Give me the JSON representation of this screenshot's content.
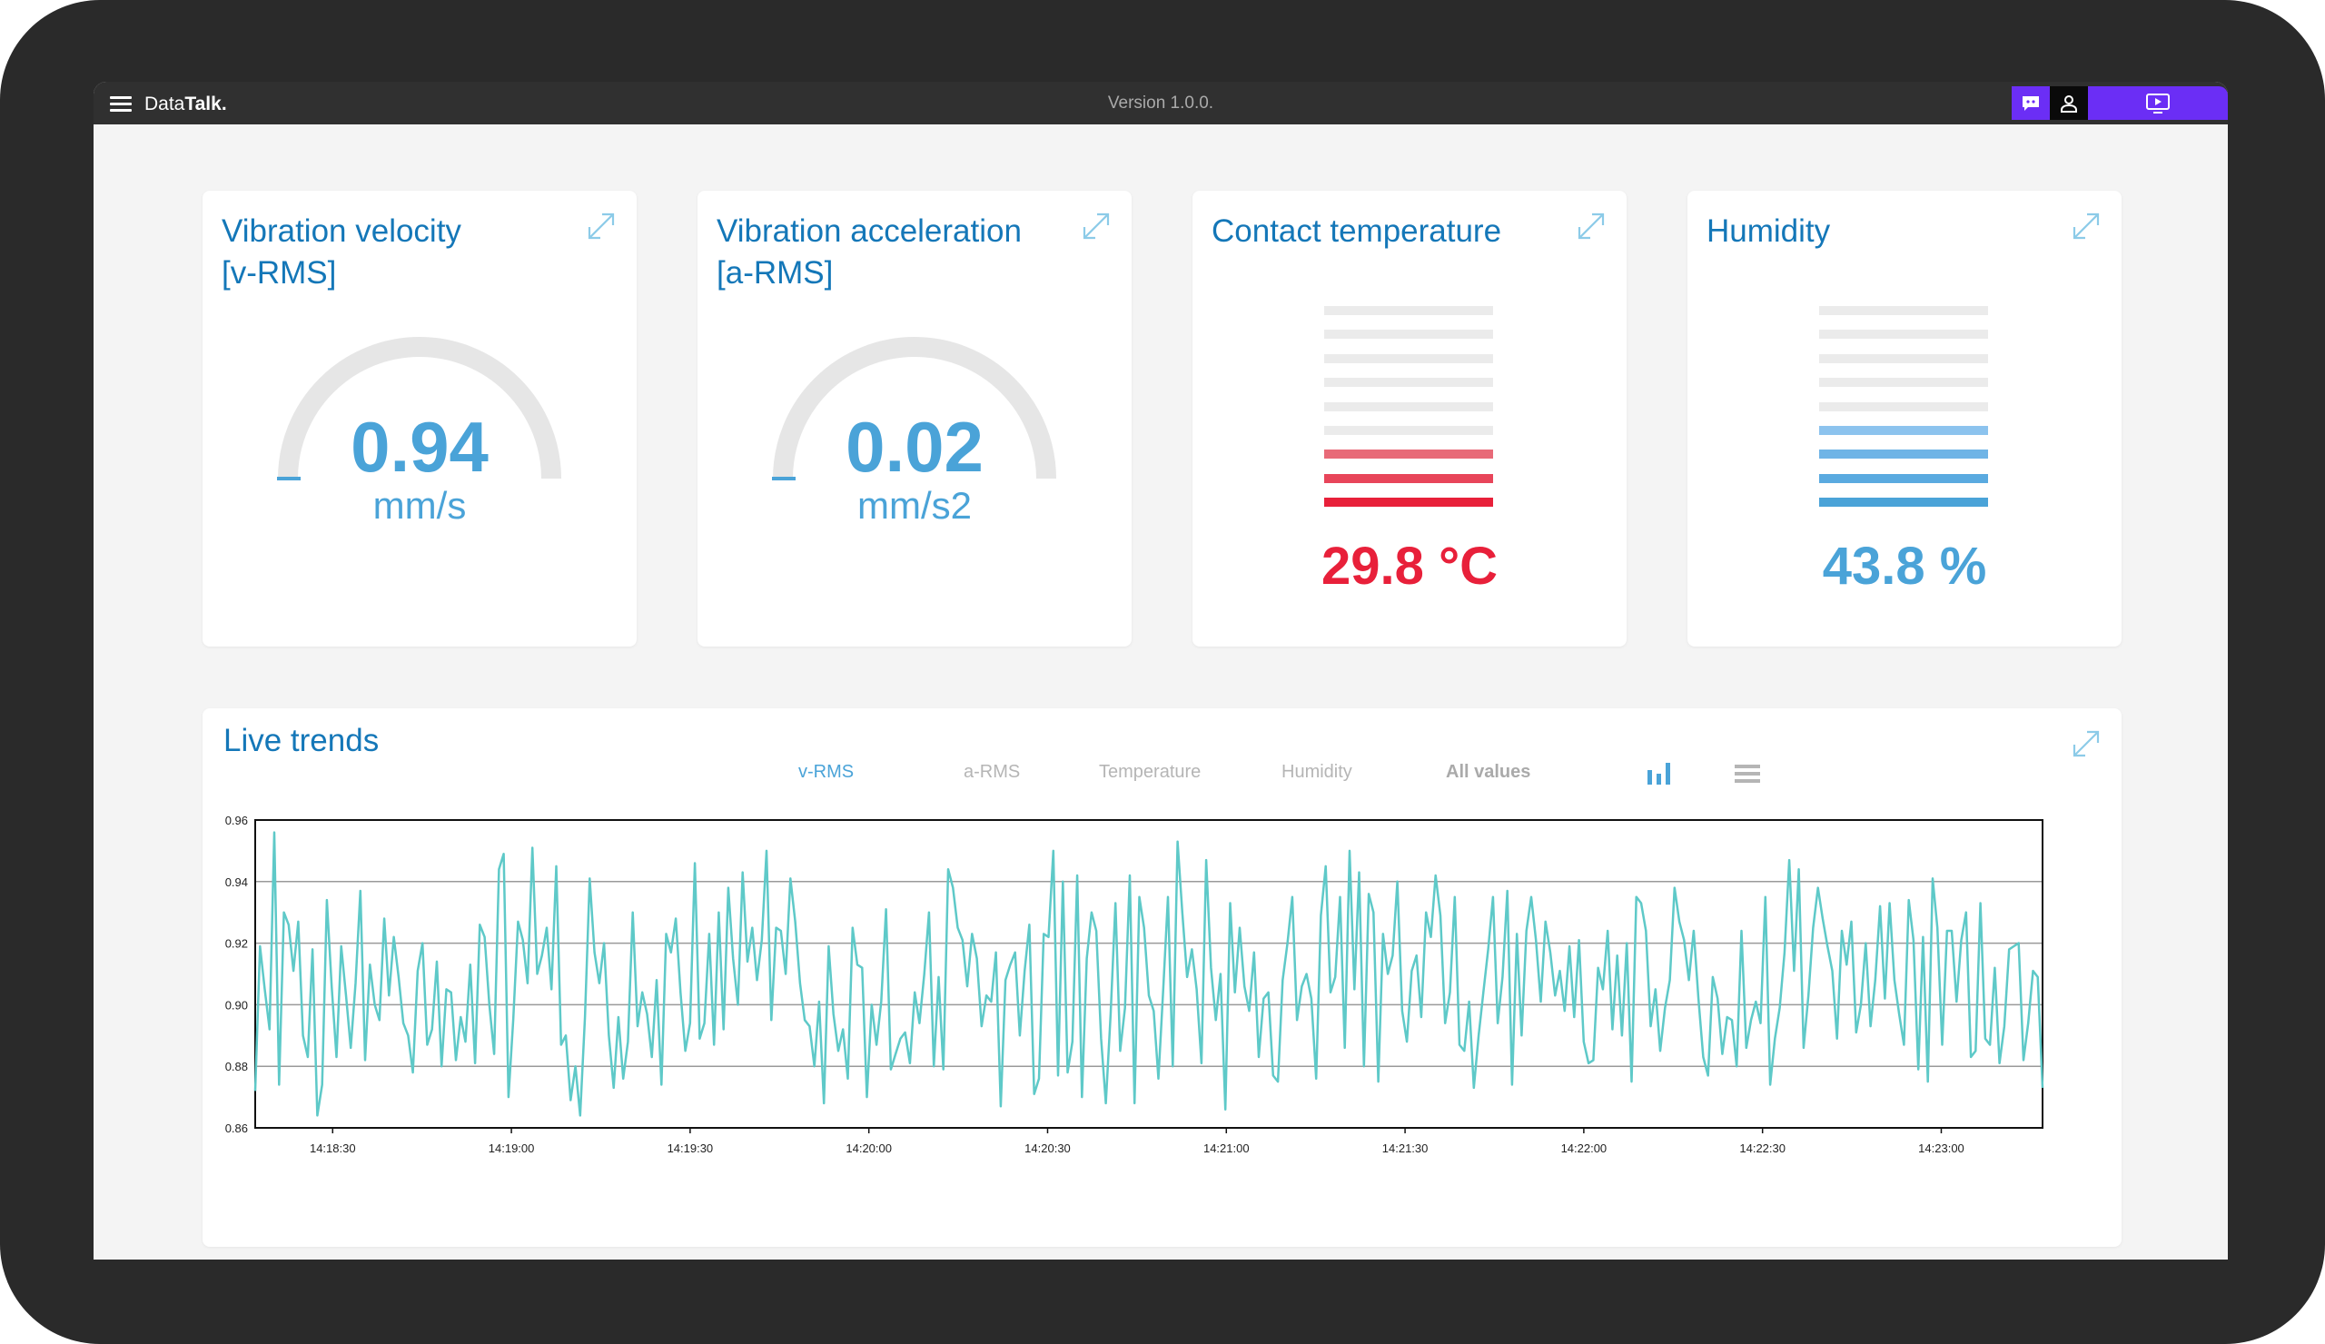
{
  "app": {
    "brand_light": "Data",
    "brand_bold": "Talk.",
    "version": "Version 1.0.0."
  },
  "toolbar": {
    "chat_icon": "chat-bubble-icon",
    "user_icon": "user-icon",
    "screen_icon": "monitor-play-icon"
  },
  "cards": [
    {
      "title_line1": "Vibration velocity",
      "title_line2": "[v-RMS]",
      "value": "0.94",
      "unit": "mm/s",
      "gauge_fraction": 0.05,
      "color": "#4aa3d8"
    },
    {
      "title_line1": "Vibration acceleration",
      "title_line2": "[a-RMS]",
      "value": "0.02",
      "unit": "mm/s2",
      "gauge_fraction": 0.02,
      "color": "#4aa3d8"
    },
    {
      "title_line1": "Contact temperature",
      "title_line2": "",
      "value": "29.8 °C",
      "level_bars": 3,
      "total_bars": 9,
      "color": "#e8203a"
    },
    {
      "title_line1": "Humidity",
      "title_line2": "",
      "value": "43.8 %",
      "level_bars": 4,
      "total_bars": 9,
      "color": "#4aa3d8"
    }
  ],
  "trends": {
    "title": "Live trends",
    "tabs": [
      "v-RMS",
      "a-RMS",
      "Temperature",
      "Humidity",
      "All values"
    ],
    "active_tab": "v-RMS",
    "icons": [
      "bar-chart-icon",
      "list-icon"
    ]
  },
  "colors": {
    "accent_blue": "#1477b8",
    "value_blue": "#4aa3d8",
    "temp_red": "#e8203a",
    "purple": "#6b2ef5",
    "line": "#5ec9c8"
  },
  "chart_data": {
    "type": "line",
    "title": "",
    "xlabel": "",
    "ylabel": "",
    "ylim": [
      0.86,
      0.96
    ],
    "yticks": [
      "0.96",
      "0.94",
      "0.92",
      "0.90",
      "0.88",
      "0.86"
    ],
    "xticks": [
      "14:18:30",
      "14:19:00",
      "14:19:30",
      "14:20:00",
      "14:20:30",
      "14:21:00",
      "14:21:30",
      "14:22:00",
      "14:22:30",
      "14:23:00"
    ],
    "x_start": "14:18:17",
    "x_end": "14:23:17",
    "grid": "horizontal",
    "series": [
      {
        "values": [
          0.872,
          0.919,
          0.905,
          0.892,
          0.956,
          0.874,
          0.93,
          0.926,
          0.911,
          0.927,
          0.89,
          0.883,
          0.918,
          0.864,
          0.874,
          0.934,
          0.906,
          0.883,
          0.919,
          0.903,
          0.886,
          0.907,
          0.937,
          0.882,
          0.913,
          0.9,
          0.895,
          0.928,
          0.903,
          0.922,
          0.909,
          0.894,
          0.89,
          0.878,
          0.911,
          0.92,
          0.887,
          0.892,
          0.914,
          0.88,
          0.905,
          0.904,
          0.882,
          0.896,
          0.888,
          0.913,
          0.881,
          0.926,
          0.922,
          0.9,
          0.884,
          0.944,
          0.949,
          0.87,
          0.895,
          0.927,
          0.921,
          0.907,
          0.951,
          0.91,
          0.916,
          0.925,
          0.905,
          0.945,
          0.887,
          0.89,
          0.869,
          0.88,
          0.864,
          0.896,
          0.941,
          0.917,
          0.907,
          0.92,
          0.89,
          0.873,
          0.896,
          0.876,
          0.888,
          0.93,
          0.893,
          0.904,
          0.897,
          0.883,
          0.908,
          0.874,
          0.923,
          0.917,
          0.928,
          0.904,
          0.885,
          0.894,
          0.946,
          0.889,
          0.894,
          0.923,
          0.887,
          0.93,
          0.892,
          0.938,
          0.915,
          0.9,
          0.943,
          0.914,
          0.925,
          0.908,
          0.921,
          0.95,
          0.895,
          0.925,
          0.924,
          0.91,
          0.941,
          0.927,
          0.907,
          0.895,
          0.893,
          0.88,
          0.901,
          0.868,
          0.919,
          0.897,
          0.885,
          0.892,
          0.876,
          0.925,
          0.913,
          0.912,
          0.87,
          0.9,
          0.887,
          0.901,
          0.931,
          0.879,
          0.884,
          0.889,
          0.891,
          0.881,
          0.904,
          0.894,
          0.91,
          0.93,
          0.88,
          0.909,
          0.879,
          0.944,
          0.938,
          0.925,
          0.921,
          0.906,
          0.923,
          0.915,
          0.893,
          0.903,
          0.901,
          0.917,
          0.867,
          0.908,
          0.913,
          0.917,
          0.89,
          0.911,
          0.926,
          0.871,
          0.876,
          0.923,
          0.922,
          0.95,
          0.877,
          0.94,
          0.878,
          0.888,
          0.942,
          0.87,
          0.915,
          0.93,
          0.924,
          0.889,
          0.868,
          0.897,
          0.933,
          0.885,
          0.899,
          0.942,
          0.868,
          0.935,
          0.925,
          0.903,
          0.898,
          0.876,
          0.905,
          0.935,
          0.88,
          0.953,
          0.93,
          0.909,
          0.918,
          0.905,
          0.881,
          0.947,
          0.912,
          0.895,
          0.91,
          0.866,
          0.933,
          0.904,
          0.925,
          0.906,
          0.898,
          0.917,
          0.883,
          0.902,
          0.904,
          0.877,
          0.875,
          0.908,
          0.92,
          0.935,
          0.895,
          0.906,
          0.91,
          0.902,
          0.876,
          0.929,
          0.945,
          0.904,
          0.909,
          0.935,
          0.886,
          0.95,
          0.905,
          0.943,
          0.88,
          0.936,
          0.93,
          0.875,
          0.923,
          0.91,
          0.916,
          0.94,
          0.898,
          0.888,
          0.911,
          0.916,
          0.896,
          0.93,
          0.922,
          0.942,
          0.929,
          0.894,
          0.904,
          0.935,
          0.887,
          0.885,
          0.901,
          0.873,
          0.89,
          0.904,
          0.918,
          0.935,
          0.894,
          0.909,
          0.937,
          0.874,
          0.923,
          0.89,
          0.924,
          0.935,
          0.921,
          0.901,
          0.927,
          0.917,
          0.903,
          0.911,
          0.898,
          0.919,
          0.896,
          0.921,
          0.888,
          0.881,
          0.882,
          0.912,
          0.905,
          0.924,
          0.892,
          0.916,
          0.89,
          0.92,
          0.875,
          0.935,
          0.933,
          0.924,
          0.893,
          0.905,
          0.885,
          0.899,
          0.908,
          0.938,
          0.927,
          0.921,
          0.908,
          0.924,
          0.902,
          0.883,
          0.877,
          0.909,
          0.902,
          0.884,
          0.896,
          0.895,
          0.88,
          0.924,
          0.886,
          0.895,
          0.901,
          0.894,
          0.935,
          0.874,
          0.889,
          0.899,
          0.917,
          0.947,
          0.911,
          0.944,
          0.886,
          0.903,
          0.925,
          0.938,
          0.928,
          0.919,
          0.911,
          0.889,
          0.924,
          0.913,
          0.927,
          0.891,
          0.9,
          0.92,
          0.893,
          0.908,
          0.932,
          0.902,
          0.933,
          0.908,
          0.897,
          0.887,
          0.934,
          0.921,
          0.879,
          0.922,
          0.875,
          0.941,
          0.925,
          0.887,
          0.924,
          0.924,
          0.901,
          0.921,
          0.93,
          0.883,
          0.885,
          0.933,
          0.889,
          0.887,
          0.912,
          0.881,
          0.893,
          0.918,
          0.919,
          0.92,
          0.882,
          0.894,
          0.911,
          0.909,
          0.873
        ]
      }
    ]
  }
}
